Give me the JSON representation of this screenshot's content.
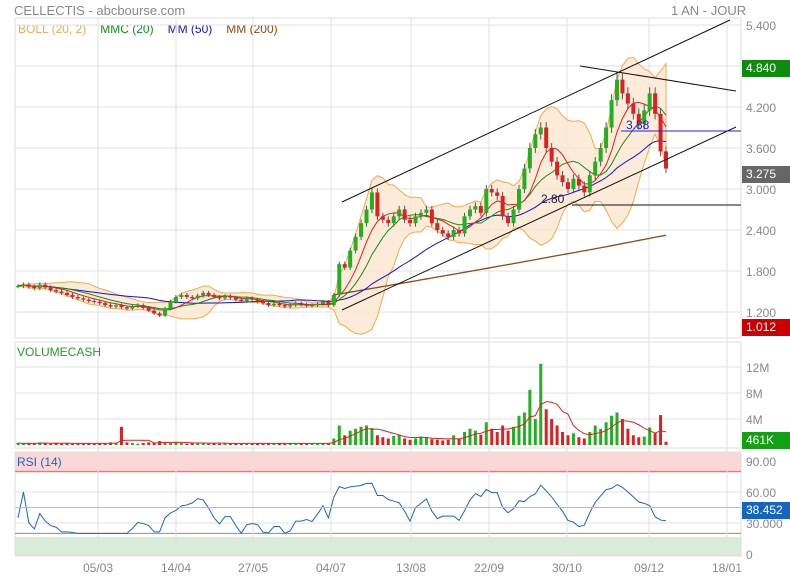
{
  "header": {
    "title": "CELLECTIS - abcbourse.com",
    "period": "1 AN - JOUR"
  },
  "legend": [
    {
      "label": "BOLL (20, 2)",
      "color": "#f5a94a"
    },
    {
      "label": "MMC (20)",
      "color": "#109010"
    },
    {
      "label": "MM (50)",
      "color": "#1010e0"
    },
    {
      "label": "MM (200)",
      "color": "#8a4a10"
    }
  ],
  "badges": {
    "high": "4.840",
    "last": "3.275",
    "low": "1.012",
    "volume": "461K",
    "rsi": "38.452"
  },
  "annotations": {
    "resistance": "3.88",
    "support": "2.80"
  },
  "panels": {
    "volume": "VOLUMECASH",
    "rsi": "RSI (14)"
  },
  "chart_data": [
    {
      "type": "candlestick",
      "title": "CELLECTIS",
      "yticks": [
        "5.400",
        "4.800",
        "4.200",
        "3.600",
        "3.000",
        "2.400",
        "1.800",
        "1.200"
      ],
      "ylim": [
        1.2,
        5.4
      ],
      "xticks": [
        "05/03",
        "14/04",
        "27/05",
        "04/07",
        "13/08",
        "22/09",
        "30/10",
        "09/12",
        "18/01"
      ],
      "close": [
        1.58,
        1.6,
        1.57,
        1.55,
        1.6,
        1.56,
        1.52,
        1.5,
        1.48,
        1.45,
        1.42,
        1.4,
        1.38,
        1.36,
        1.35,
        1.33,
        1.3,
        1.28,
        1.3,
        1.27,
        1.25,
        1.28,
        1.3,
        1.26,
        1.22,
        1.18,
        1.15,
        1.25,
        1.35,
        1.42,
        1.45,
        1.42,
        1.4,
        1.44,
        1.48,
        1.45,
        1.42,
        1.4,
        1.43,
        1.41,
        1.38,
        1.36,
        1.4,
        1.38,
        1.35,
        1.33,
        1.3,
        1.32,
        1.3,
        1.28,
        1.3,
        1.33,
        1.31,
        1.29,
        1.3,
        1.32,
        1.35,
        1.3,
        1.45,
        1.9,
        1.85,
        2.1,
        2.3,
        2.5,
        2.7,
        2.95,
        2.6,
        2.55,
        2.5,
        2.6,
        2.7,
        2.55,
        2.5,
        2.6,
        2.65,
        2.7,
        2.5,
        2.4,
        2.35,
        2.3,
        2.4,
        2.35,
        2.6,
        2.7,
        2.75,
        2.65,
        3.0,
        2.95,
        2.9,
        2.6,
        2.5,
        2.7,
        3.0,
        3.3,
        3.6,
        3.8,
        3.9,
        3.6,
        3.4,
        3.2,
        3.1,
        3.0,
        3.15,
        3.05,
        2.95,
        3.2,
        3.4,
        3.6,
        3.9,
        4.3,
        4.6,
        4.4,
        4.25,
        4.1,
        3.95,
        4.15,
        4.4,
        4.1,
        3.55,
        3.3
      ]
    },
    {
      "type": "bar",
      "title": "VOLUMECASH",
      "yticks": [
        "12M",
        "8M",
        "4M"
      ],
      "ylim": [
        0,
        14
      ],
      "values": [
        0.3,
        0.2,
        0.3,
        0.2,
        0.4,
        0.3,
        0.2,
        0.3,
        0.2,
        0.3,
        0.2,
        0.3,
        0.2,
        0.3,
        0.2,
        0.3,
        0.2,
        0.4,
        0.3,
        2.8,
        0.4,
        0.3,
        0.2,
        0.3,
        0.4,
        0.3,
        0.6,
        0.5,
        0.3,
        0.4,
        0.3,
        0.2,
        0.3,
        0.4,
        0.3,
        0.2,
        0.3,
        0.2,
        0.3,
        0.2,
        0.3,
        0.2,
        0.3,
        0.2,
        0.3,
        0.2,
        0.3,
        0.2,
        0.3,
        0.2,
        0.3,
        0.2,
        0.3,
        0.2,
        0.3,
        0.2,
        0.3,
        0.2,
        1.0,
        3.0,
        1.5,
        2.2,
        2.5,
        2.8,
        3.0,
        2.6,
        1.5,
        1.2,
        1.0,
        1.4,
        1.6,
        1.0,
        0.8,
        1.0,
        1.3,
        1.2,
        0.9,
        0.8,
        0.7,
        0.8,
        1.5,
        1.0,
        2.0,
        2.5,
        2.2,
        1.6,
        3.5,
        2.5,
        2.0,
        3.0,
        2.2,
        2.8,
        4.5,
        5.0,
        8.5,
        4.0,
        12.5,
        5.5,
        4.0,
        3.0,
        2.0,
        1.5,
        1.8,
        1.2,
        1.0,
        2.0,
        3.0,
        2.5,
        3.5,
        4.5,
        5.0,
        4.0,
        2.5,
        1.5,
        1.2,
        1.3,
        2.7,
        1.8,
        4.6,
        0.5
      ]
    },
    {
      "type": "line",
      "title": "RSI (14)",
      "yticks": [
        "90.00",
        "60.00",
        "30.000",
        "0"
      ],
      "ylim": [
        0,
        100
      ],
      "overbought": 80,
      "oversold": 20
    }
  ]
}
